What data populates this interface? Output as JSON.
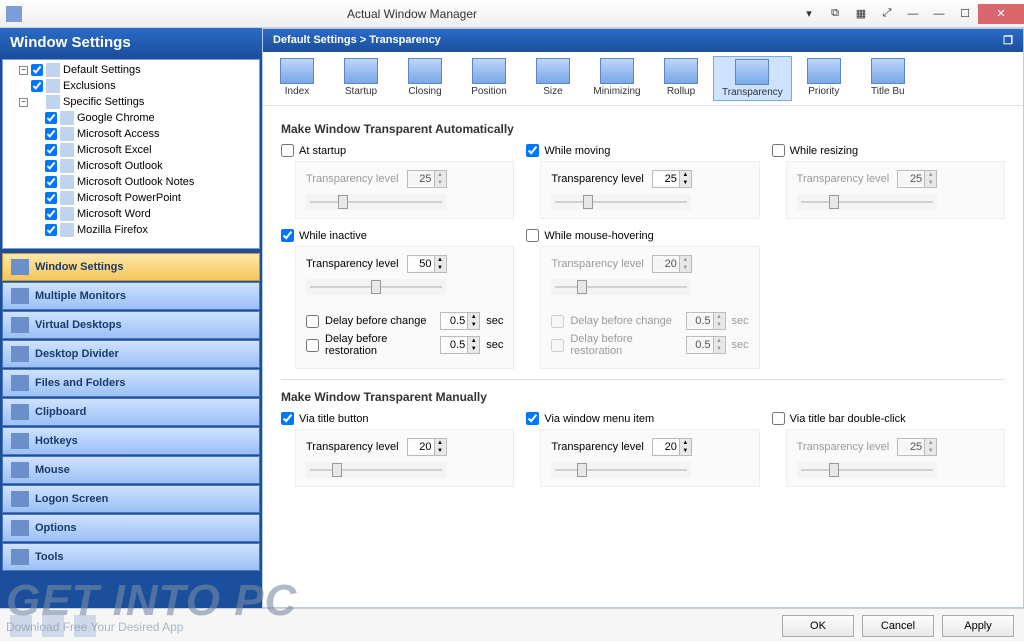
{
  "title": "Actual Window Manager",
  "sidebar_header": "Window Settings",
  "tree": {
    "root": "Default Settings",
    "exclusions": "Exclusions",
    "specific": "Specific Settings",
    "apps": [
      "Google Chrome",
      "Microsoft Access",
      "Microsoft Excel",
      "Microsoft Outlook",
      "Microsoft Outlook Notes",
      "Microsoft PowerPoint",
      "Microsoft Word",
      "Mozilla Firefox"
    ]
  },
  "nav": [
    "Window Settings",
    "Multiple Monitors",
    "Virtual Desktops",
    "Desktop Divider",
    "Files and Folders",
    "Clipboard",
    "Hotkeys",
    "Mouse",
    "Logon Screen",
    "Options",
    "Tools"
  ],
  "nav_selected": 0,
  "breadcrumb": "Default Settings > Transparency",
  "toolbar": [
    "Index",
    "Startup",
    "Closing",
    "Position",
    "Size",
    "Minimizing",
    "Rollup",
    "Transparency",
    "Priority",
    "Title Bu"
  ],
  "toolbar_selected": 7,
  "section_auto": "Make Window Transparent Automatically",
  "section_manual": "Make Window Transparent Manually",
  "labels": {
    "at_startup": "At startup",
    "while_moving": "While moving",
    "while_resizing": "While resizing",
    "while_inactive": "While inactive",
    "while_hover": "While mouse-hovering",
    "trans_level": "Transparency level",
    "delay_change": "Delay before change",
    "delay_restore": "Delay before restoration",
    "sec": "sec",
    "via_title": "Via title button",
    "via_menu": "Via window menu item",
    "via_dblclick": "Via title bar double-click"
  },
  "values": {
    "startup_level": "25",
    "moving_level": "25",
    "resizing_level": "25",
    "inactive_level": "50",
    "hover_level": "20",
    "inactive_delay_change": "0.5",
    "inactive_delay_restore": "0.5",
    "hover_delay_change": "0.5",
    "hover_delay_restore": "0.5",
    "title_level": "20",
    "menu_level": "20",
    "dblclick_level": "25"
  },
  "checks": {
    "at_startup": false,
    "while_moving": true,
    "while_resizing": false,
    "while_inactive": true,
    "while_hover": false,
    "inactive_delay_change": false,
    "inactive_delay_restore": false,
    "hover_delay_change": false,
    "hover_delay_restore": false,
    "via_title": true,
    "via_menu": true,
    "via_dblclick": false
  },
  "buttons": {
    "ok": "OK",
    "cancel": "Cancel",
    "apply": "Apply"
  },
  "watermark": {
    "big": "GET INTO PC",
    "small": "Download Free Your Desired App"
  }
}
